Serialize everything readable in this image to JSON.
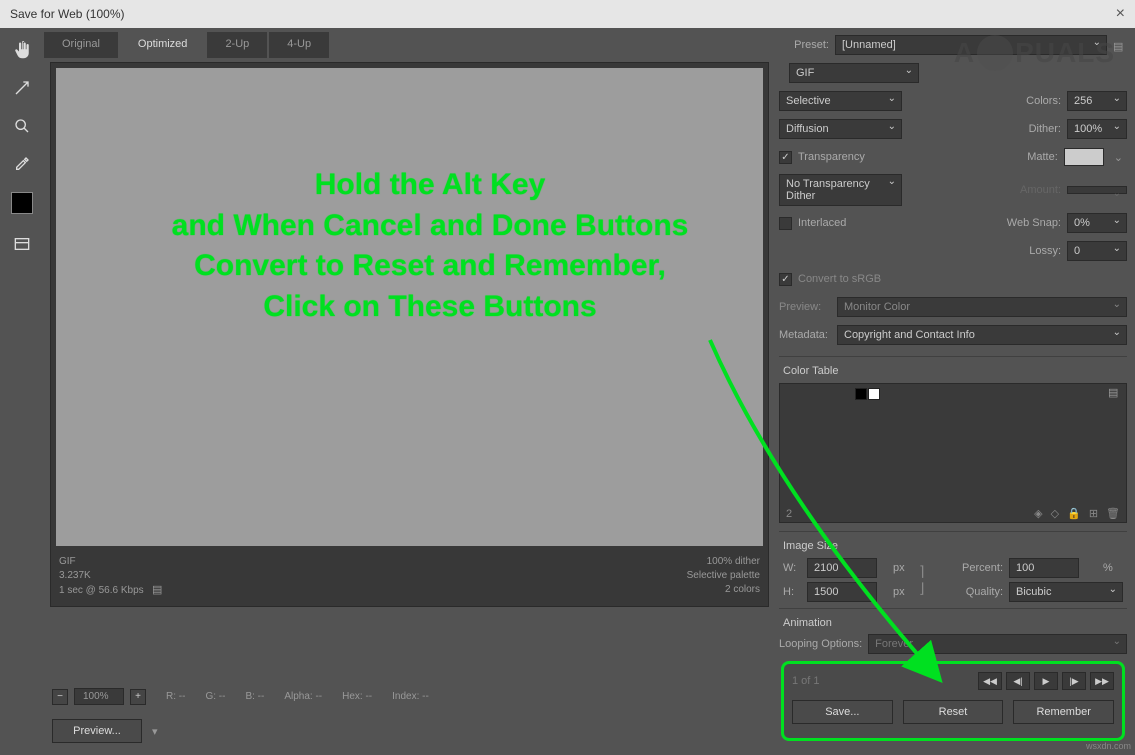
{
  "window": {
    "title": "Save for Web (100%)"
  },
  "tabs": {
    "original": "Original",
    "optimized": "Optimized",
    "two_up": "2-Up",
    "four_up": "4-Up"
  },
  "canvas": {
    "format": "GIF",
    "size": "3.237K",
    "timing": "1 sec @ 56.6 Kbps",
    "dither_pct": "100% dither",
    "palette": "Selective palette",
    "colors": "2 colors"
  },
  "info": {
    "zoom": "100%",
    "r": "R: --",
    "g": "G: --",
    "b": "B: --",
    "alpha": "Alpha: --",
    "hex": "Hex: --",
    "index": "Index: --"
  },
  "buttons": {
    "preview": "Preview...",
    "save": "Save...",
    "reset": "Reset",
    "remember": "Remember"
  },
  "preset": {
    "label": "Preset:",
    "value": "[Unnamed]",
    "format": "GIF",
    "reduction": "Selective",
    "colors_label": "Colors:",
    "colors": "256",
    "dither_method": "Diffusion",
    "dither_label": "Dither:",
    "dither": "100%",
    "transparency": "Transparency",
    "matte_label": "Matte:",
    "trans_dither": "No Transparency Dither",
    "amount_label": "Amount:",
    "interlaced": "Interlaced",
    "websnap_label": "Web Snap:",
    "websnap": "0%",
    "lossy_label": "Lossy:",
    "lossy": "0",
    "convert_srgb": "Convert to sRGB",
    "preview_label": "Preview:",
    "preview_val": "Monitor Color",
    "metadata_label": "Metadata:",
    "metadata_val": "Copyright and Contact Info"
  },
  "color_table": {
    "header": "Color Table",
    "count": "2"
  },
  "image_size": {
    "header": "Image Size",
    "w_label": "W:",
    "w": "2100",
    "px": "px",
    "h_label": "H:",
    "h": "1500",
    "percent_label": "Percent:",
    "percent": "100",
    "pct_sym": "%",
    "quality_label": "Quality:",
    "quality": "Bicubic"
  },
  "animation": {
    "header": "Animation",
    "loop_label": "Looping Options:",
    "loop_val": "Forever",
    "frame": "1 of 1"
  },
  "annotation": {
    "line1": "Hold the Alt Key",
    "line2": "and When Cancel and Done Buttons",
    "line3": "Convert to Reset and Remember,",
    "line4": "Click on These Buttons"
  },
  "watermark": {
    "pre": "A",
    "post": "PUALS"
  },
  "source": "wsxdn.com"
}
